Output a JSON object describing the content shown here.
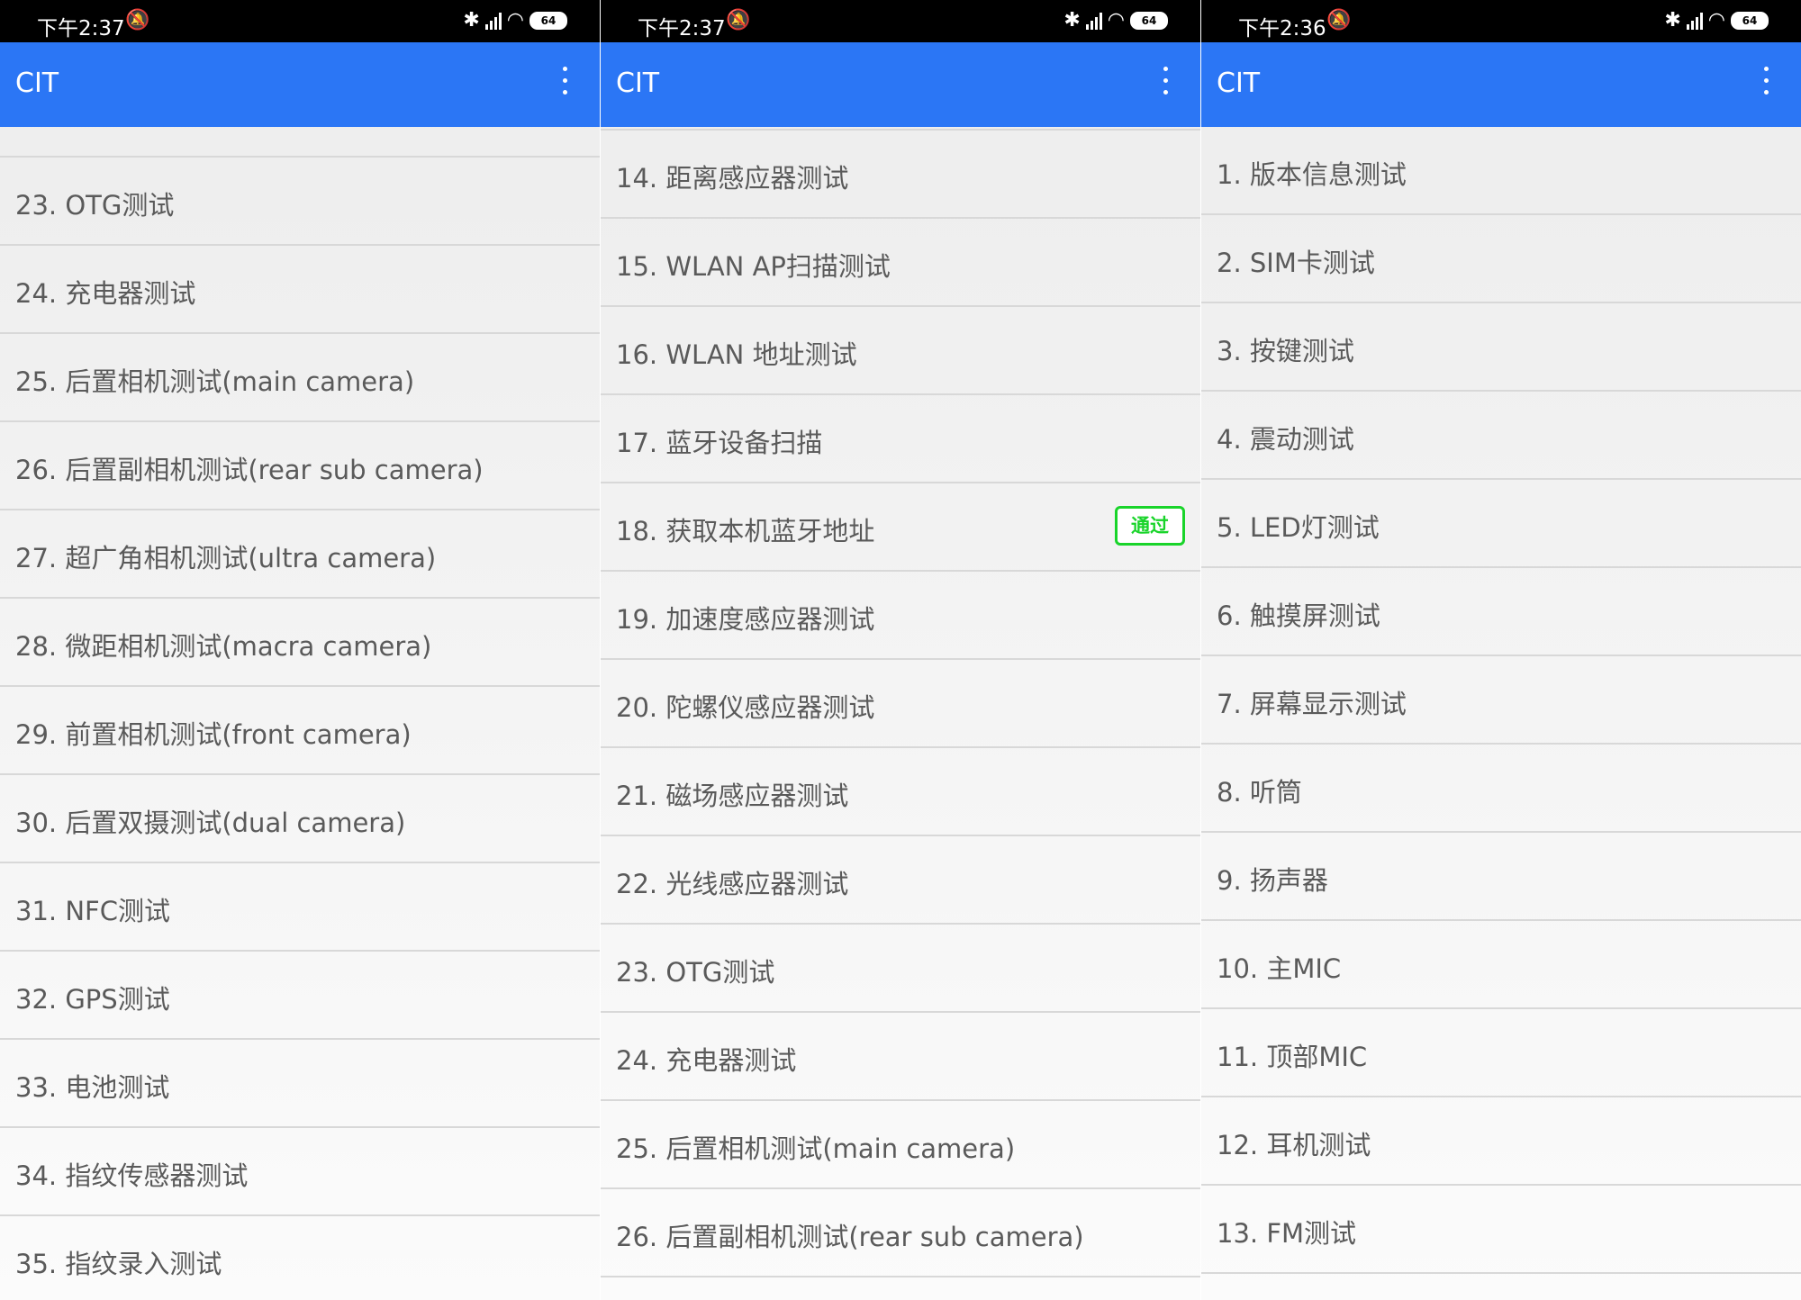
{
  "screens": [
    {
      "status": {
        "time": "下午2:37",
        "battery": "64"
      },
      "app_title": "CIT",
      "items": [
        {
          "label": "23. OTG测试"
        },
        {
          "label": "24. 充电器测试"
        },
        {
          "label": "25. 后置相机测试(main camera)"
        },
        {
          "label": "26. 后置副相机测试(rear sub camera)"
        },
        {
          "label": "27. 超广角相机测试(ultra camera)"
        },
        {
          "label": "28. 微距相机测试(macra camera)"
        },
        {
          "label": "29. 前置相机测试(front camera)"
        },
        {
          "label": "30. 后置双摄测试(dual camera)"
        },
        {
          "label": "31. NFC测试"
        },
        {
          "label": "32. GPS测试"
        },
        {
          "label": "33. 电池测试"
        },
        {
          "label": "34. 指纹传感器测试"
        },
        {
          "label": "35. 指纹录入测试"
        }
      ]
    },
    {
      "status": {
        "time": "下午2:37",
        "battery": "64"
      },
      "app_title": "CIT",
      "items": [
        {
          "label": "14. 距离感应器测试"
        },
        {
          "label": "15. WLAN AP扫描测试"
        },
        {
          "label": "16. WLAN 地址测试"
        },
        {
          "label": "17. 蓝牙设备扫描"
        },
        {
          "label": "18. 获取本机蓝牙地址",
          "badge": "通过"
        },
        {
          "label": "19. 加速度感应器测试"
        },
        {
          "label": "20. 陀螺仪感应器测试"
        },
        {
          "label": "21. 磁场感应器测试"
        },
        {
          "label": "22. 光线感应器测试"
        },
        {
          "label": "23. OTG测试"
        },
        {
          "label": "24. 充电器测试"
        },
        {
          "label": "25. 后置相机测试(main camera)"
        },
        {
          "label": "26. 后置副相机测试(rear sub camera)"
        }
      ]
    },
    {
      "status": {
        "time": "下午2:36",
        "battery": "64"
      },
      "app_title": "CIT",
      "items": [
        {
          "label": "1. 版本信息测试"
        },
        {
          "label": "2. SIM卡测试"
        },
        {
          "label": "3. 按键测试"
        },
        {
          "label": "4. 震动测试"
        },
        {
          "label": "5. LED灯测试"
        },
        {
          "label": "6. 触摸屏测试"
        },
        {
          "label": "7. 屏幕显示测试"
        },
        {
          "label": "8. 听筒"
        },
        {
          "label": "9. 扬声器"
        },
        {
          "label": "10. 主MIC"
        },
        {
          "label": "11. 顶部MIC"
        },
        {
          "label": "12. 耳机测试"
        },
        {
          "label": "13. FM测试"
        }
      ]
    }
  ]
}
